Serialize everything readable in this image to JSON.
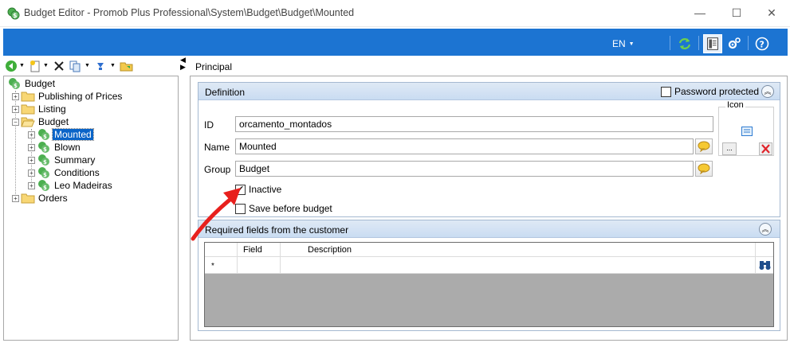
{
  "window": {
    "title": "Budget Editor - Promob Plus Professional\\System\\Budget\\Budget\\Mounted",
    "minimize_glyph": "—",
    "maximize_glyph": "☐",
    "close_glyph": "✕"
  },
  "ribbon": {
    "language": "EN",
    "background_color": "#1c74d2",
    "icons": [
      "refresh-icon",
      "layout-icon",
      "settings-icon",
      "help-icon"
    ]
  },
  "toolbar": {
    "icons": [
      "back-icon",
      "new-icon",
      "delete-icon",
      "copy-icon",
      "move-icon",
      "import-icon"
    ]
  },
  "tree": {
    "root": "Budget",
    "items": [
      {
        "label": "Publishing of Prices",
        "type": "folder"
      },
      {
        "label": "Listing",
        "type": "folder"
      },
      {
        "label": "Budget",
        "type": "folder",
        "expanded": true,
        "children": [
          {
            "label": "Mounted",
            "selected": true
          },
          {
            "label": "Blown"
          },
          {
            "label": "Summary"
          },
          {
            "label": "Conditions"
          },
          {
            "label": "Leo Madeiras"
          }
        ]
      },
      {
        "label": "Orders",
        "type": "folder"
      }
    ]
  },
  "principal_label": "Principal",
  "definition": {
    "title": "Definition",
    "password_protected_label": "Password protected",
    "password_protected": false,
    "id_label": "ID",
    "id_value": "orcamento_montados",
    "name_label": "Name",
    "name_value": "Mounted",
    "group_label": "Group",
    "group_value": "Budget",
    "icon_label": "Icon",
    "icon_browse": "...",
    "inactive_label": "Inactive",
    "inactive": true,
    "save_before_label": "Save before budget",
    "save_before": false
  },
  "required_fields": {
    "title": "Required fields from the customer",
    "columns": [
      "Field",
      "Description"
    ],
    "new_row_marker": "*"
  }
}
